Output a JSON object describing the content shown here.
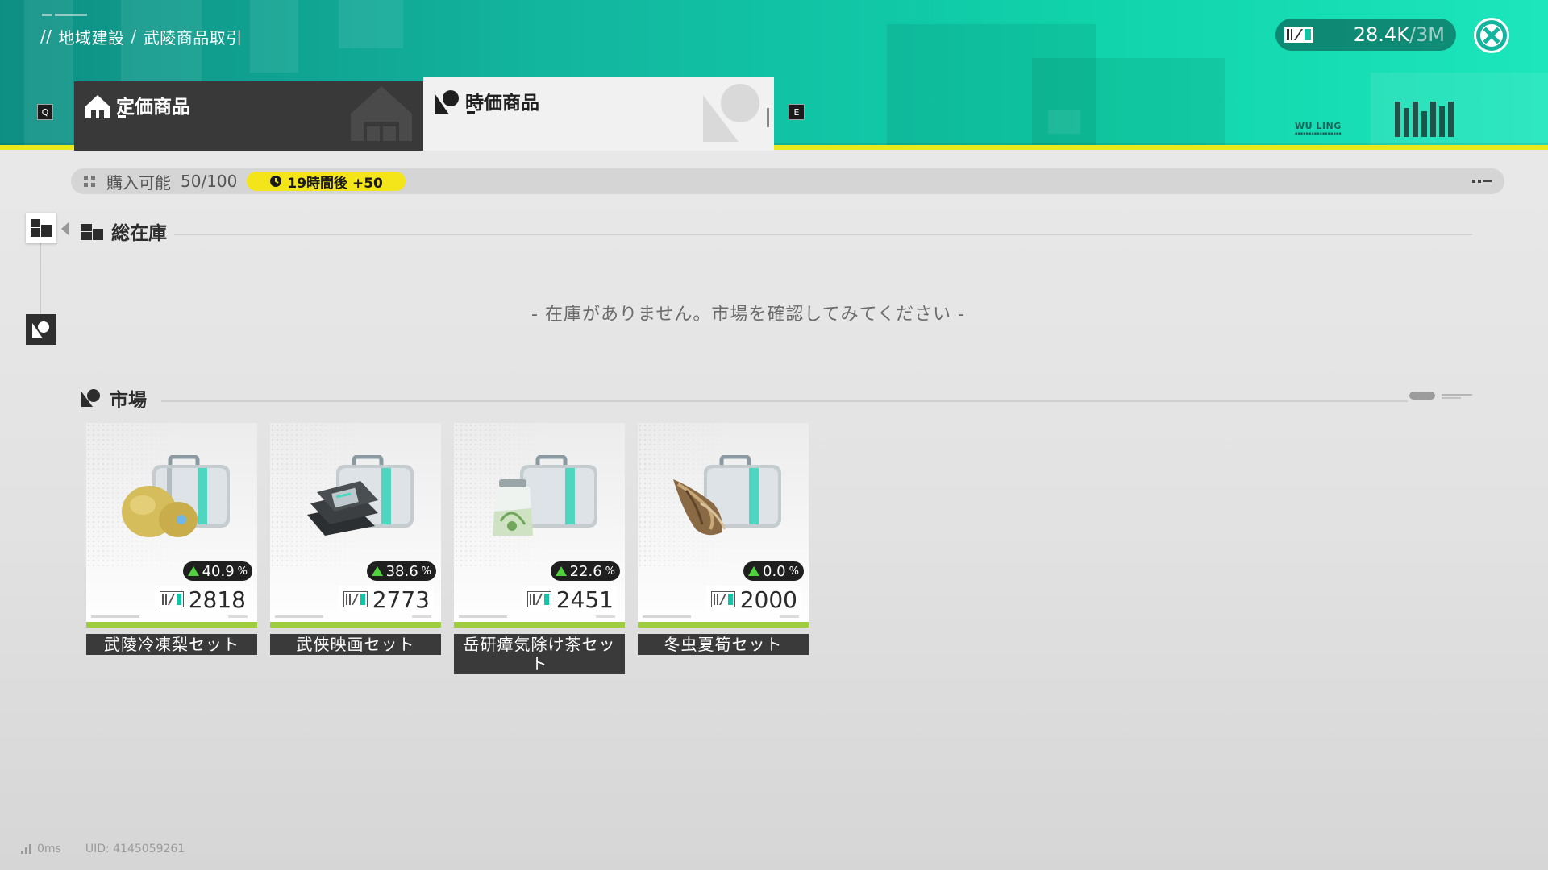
{
  "header": {
    "breadcrumb": {
      "prefix": "//",
      "region": "地域建設",
      "separator": "/",
      "page": "武陵商品取引"
    },
    "currency": {
      "amount": "28.4K",
      "max": "/3M",
      "icon": "ticket-icon"
    },
    "close_icon": "close-icon",
    "tabs": [
      {
        "label": "定価商品",
        "icon": "house-icon",
        "key": "Q",
        "active": false
      },
      {
        "label": "時価商品",
        "icon": "market-icon",
        "key": "E",
        "active": true
      }
    ],
    "brand_text": "WU LING"
  },
  "purchase": {
    "label": "購入可能",
    "count": "50/100",
    "timer": "19時間後 +50",
    "timer_icon": "clock-icon"
  },
  "inventory": {
    "title": "総在庫",
    "empty_message": "- 在庫がありません。市場を確認してみてください -"
  },
  "market": {
    "title": "市場",
    "items": [
      {
        "name": "武陵冷凍梨セット",
        "trend": "40.9",
        "price": "2818",
        "art": "pear-case"
      },
      {
        "name": "武侠映画セット",
        "trend": "38.6",
        "price": "2773",
        "art": "film-case"
      },
      {
        "name": "岳研瘴気除け茶セット",
        "trend": "22.6",
        "price": "2451",
        "art": "tea-case"
      },
      {
        "name": "冬虫夏筍セット",
        "trend": "0.0",
        "price": "2000",
        "art": "bamboo-case"
      }
    ],
    "percent_symbol": "%"
  },
  "footer": {
    "ping": "0ms",
    "uid": "UID: 4145059261"
  },
  "colors": {
    "accent": "#12c4a6",
    "stripe": "#e8ea1c",
    "timer_bg": "#f3e519",
    "trend_up": "#4ed43a"
  }
}
